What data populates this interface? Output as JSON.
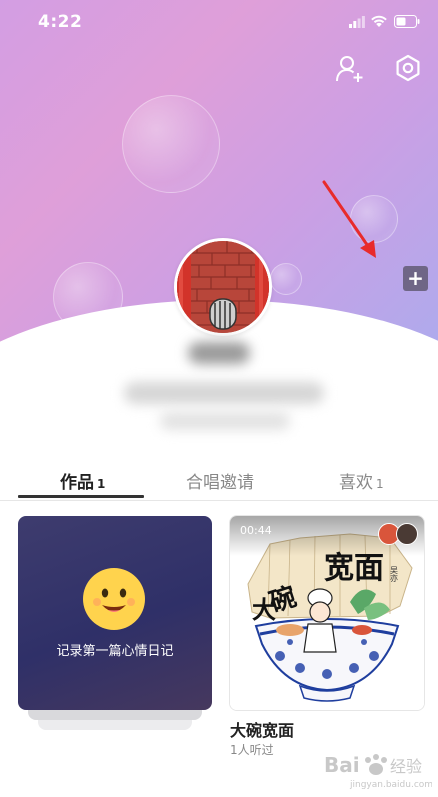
{
  "status_bar": {
    "time": "4:22"
  },
  "tabs": [
    {
      "label": "作品",
      "count": "1"
    },
    {
      "label": "合唱邀请",
      "count": ""
    },
    {
      "label": "喜欢",
      "count": "1"
    }
  ],
  "plus_button": {
    "label": "+"
  },
  "works": [
    {
      "empty_text": "记录第一篇心情日记"
    },
    {
      "duration": "00:44",
      "title": "大碗宽面",
      "listeners": "1人听过"
    }
  ],
  "watermark": {
    "brand": "Baidu 经验",
    "url": "jingyan.baidu.com"
  },
  "colors": {
    "accent_arrow": "#e82b2b",
    "active_tab": "#222222",
    "plus_bg": "#6f6686"
  }
}
